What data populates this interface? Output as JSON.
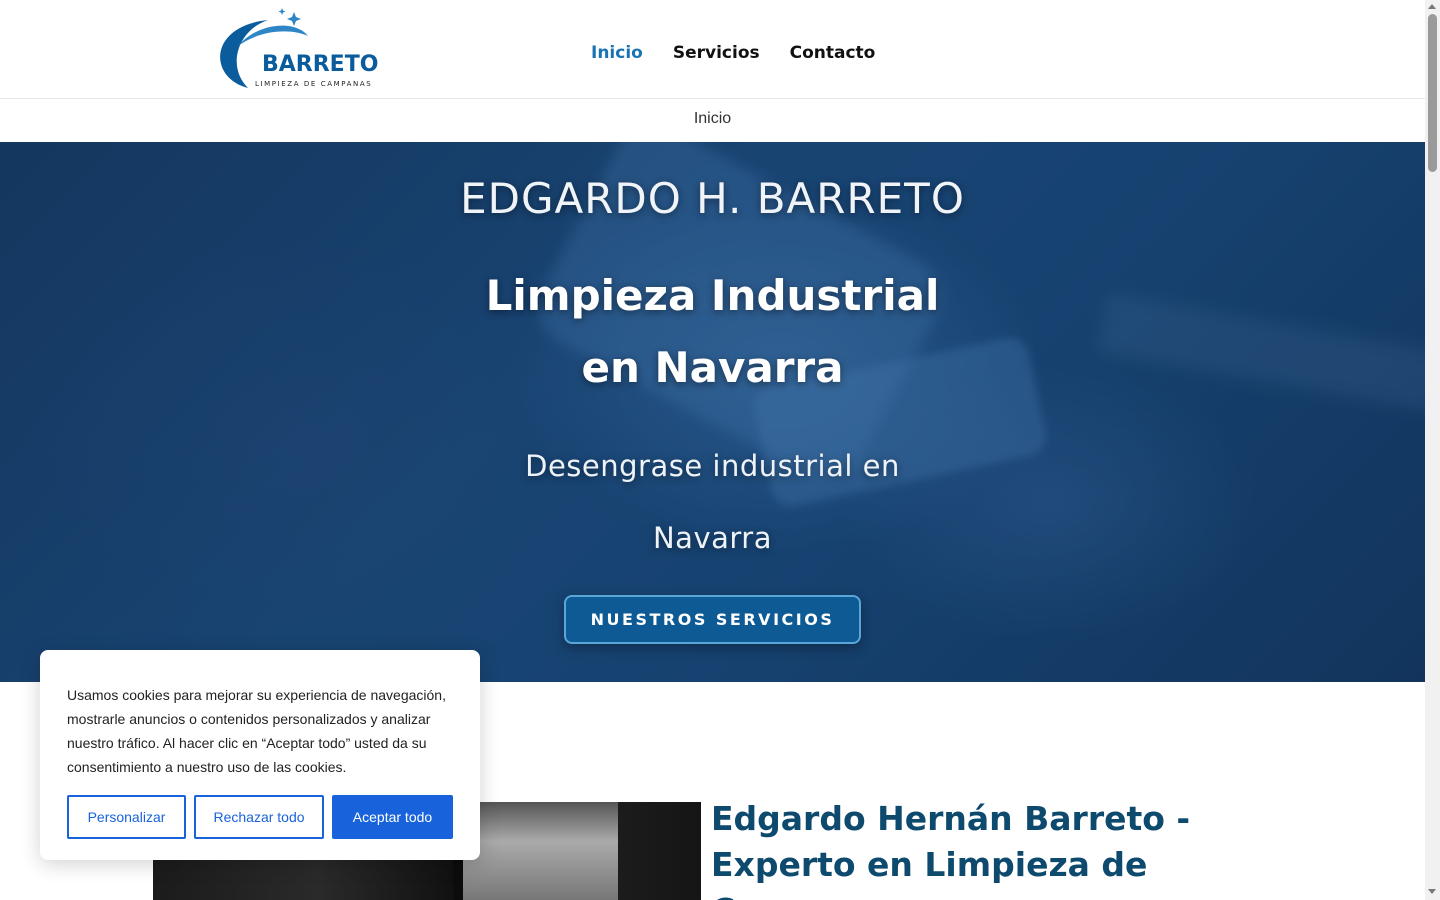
{
  "header": {
    "logo": {
      "brand": "BARRETO",
      "tagline": "LIMPIEZA DE CAMPANAS",
      "color": "#0a5c9c"
    },
    "nav": [
      {
        "label": "Inicio",
        "active": true
      },
      {
        "label": "Servicios",
        "active": false
      },
      {
        "label": "Contacto",
        "active": false
      }
    ]
  },
  "breadcrumb": {
    "current": "Inicio"
  },
  "hero": {
    "owner": "EDGARDO H. BARRETO",
    "title_line1": "Limpieza Industrial",
    "title_line2": "en Navarra",
    "subtitle_line1": "Desengrase industrial en",
    "subtitle_line2": "Navarra",
    "cta_label": "NUESTROS SERVICIOS"
  },
  "about": {
    "title": "Edgardo Hernán Barreto - Experto en Limpieza de Campanas"
  },
  "cookie_banner": {
    "text": "Usamos cookies para mejorar su experiencia de navegación, mostrarle anuncios o contenidos personalizados y analizar nuestro tráfico. Al hacer clic en “Aceptar todo” usted da su consentimiento a nuestro uso de las cookies.",
    "customize_label": "Personalizar",
    "reject_label": "Rechazar todo",
    "accept_label": "Aceptar todo",
    "accent_color": "#1863dc"
  },
  "colors": {
    "nav_active": "#1a74b3",
    "hero_base": "#1d4f82",
    "about_title": "#0d4a6e"
  },
  "icons": [
    "logo-swoosh-icon",
    "sparkle-icon",
    "scroll-up-arrow-icon",
    "scroll-down-arrow-icon"
  ]
}
